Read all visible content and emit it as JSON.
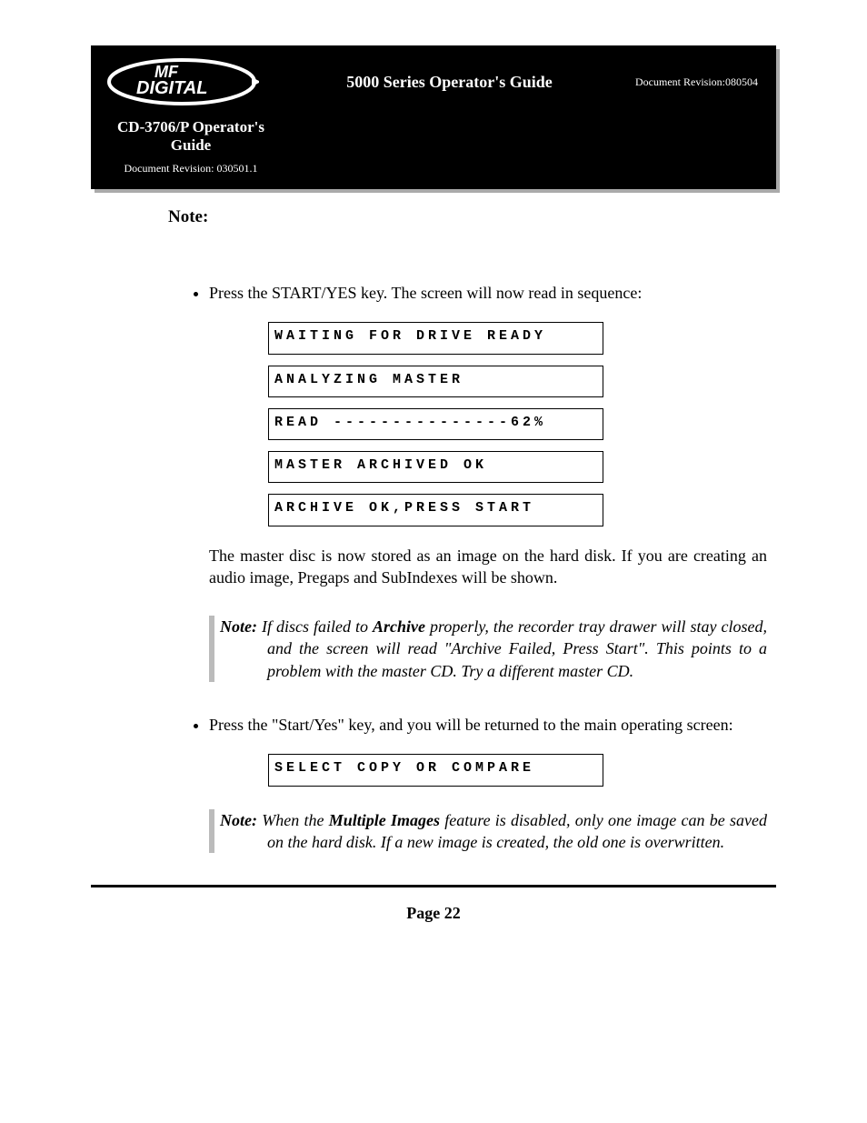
{
  "header": {
    "logo_text_top": "MF",
    "logo_text_bottom": "DIGITAL",
    "title_center": "5000 Series Operator's Guide",
    "revision_right": "Document Revision:080504",
    "subtitle": "CD-3706/P Operator's Guide",
    "sub_revision": "Document Revision: 030501.1"
  },
  "note_label": "Note:",
  "bullet_1": "Press the START/YES key. The screen will now read in sequence:",
  "lcd_lines": {
    "l1": "WAITING FOR DRIVE READY",
    "l2": "ANALYZING MASTER",
    "l3": "READ ---------------62%",
    "l4": "MASTER ARCHIVED OK",
    "l5": "ARCHIVE OK,PRESS START"
  },
  "paragraph_after_lcd": "The master disc is now stored as an image on the hard disk. If you are creating an audio image, Pregaps and SubIndexes will be shown.",
  "note1_label": "Note:",
  "note1_pre": " If discs failed to ",
  "note1_bold": "Archive",
  "note1_post": " properly, the recorder tray drawer will stay closed, and the screen will read \"Archive Failed, Press Start\". This points to a problem with the master CD. Try a different master CD.",
  "bullet_2": "Press the \"Start/Yes\" key, and you will be returned to the main operating screen:",
  "lcd_single": "SELECT COPY OR COMPARE",
  "note2_label": "Note:",
  "note2_pre": " When the ",
  "note2_bold": "Multiple Images",
  "note2_post": " feature is disabled, only one image can be saved on the hard disk. If a new image is created, the old one is overwritten.",
  "page_number": "Page 22"
}
